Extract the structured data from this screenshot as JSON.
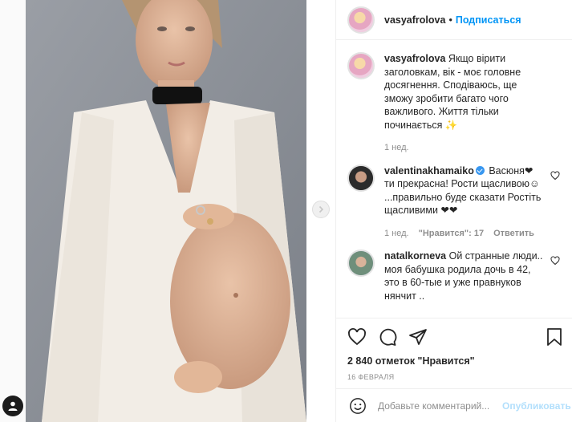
{
  "post": {
    "username": "vasyafrolova",
    "follow_label": "Подписаться",
    "separator": "•"
  },
  "caption": {
    "username": "vasyafrolova",
    "text": "Якщо вірити заголовкам, вік - моє головне досягнення. Сподіваюсь, ще зможу зробити багато чого важливого. Життя тільки починається ✨",
    "time": "1 нед."
  },
  "comments": [
    {
      "username": "valentinakhamaiko",
      "verified": true,
      "text": "Васюня❤ ти прекрасна! Рости щасливою☺ ...правильно буде сказати Ростіть щасливими ❤❤",
      "time": "1 нед.",
      "likes": "\"Нравится\": 17",
      "reply": "Ответить"
    },
    {
      "username": "natalkorneva",
      "text": "Ой странные люди.. моя бабушка родила дочь в 42, это в 60-тые и уже правнуков нянчит .."
    }
  ],
  "actions": {
    "likes_count": "2 840 отметок \"Нравится\"",
    "date": "16 ФЕВРАЛЯ"
  },
  "comment_box": {
    "placeholder": "Добавьте комментарий...",
    "post_label": "Опубликовать"
  },
  "icons": {
    "like": "heart-icon",
    "comment": "comment-icon",
    "share": "share-icon",
    "save": "bookmark-icon",
    "emoji": "smiley-icon",
    "next": "chevron-right-icon",
    "account": "user-icon"
  }
}
